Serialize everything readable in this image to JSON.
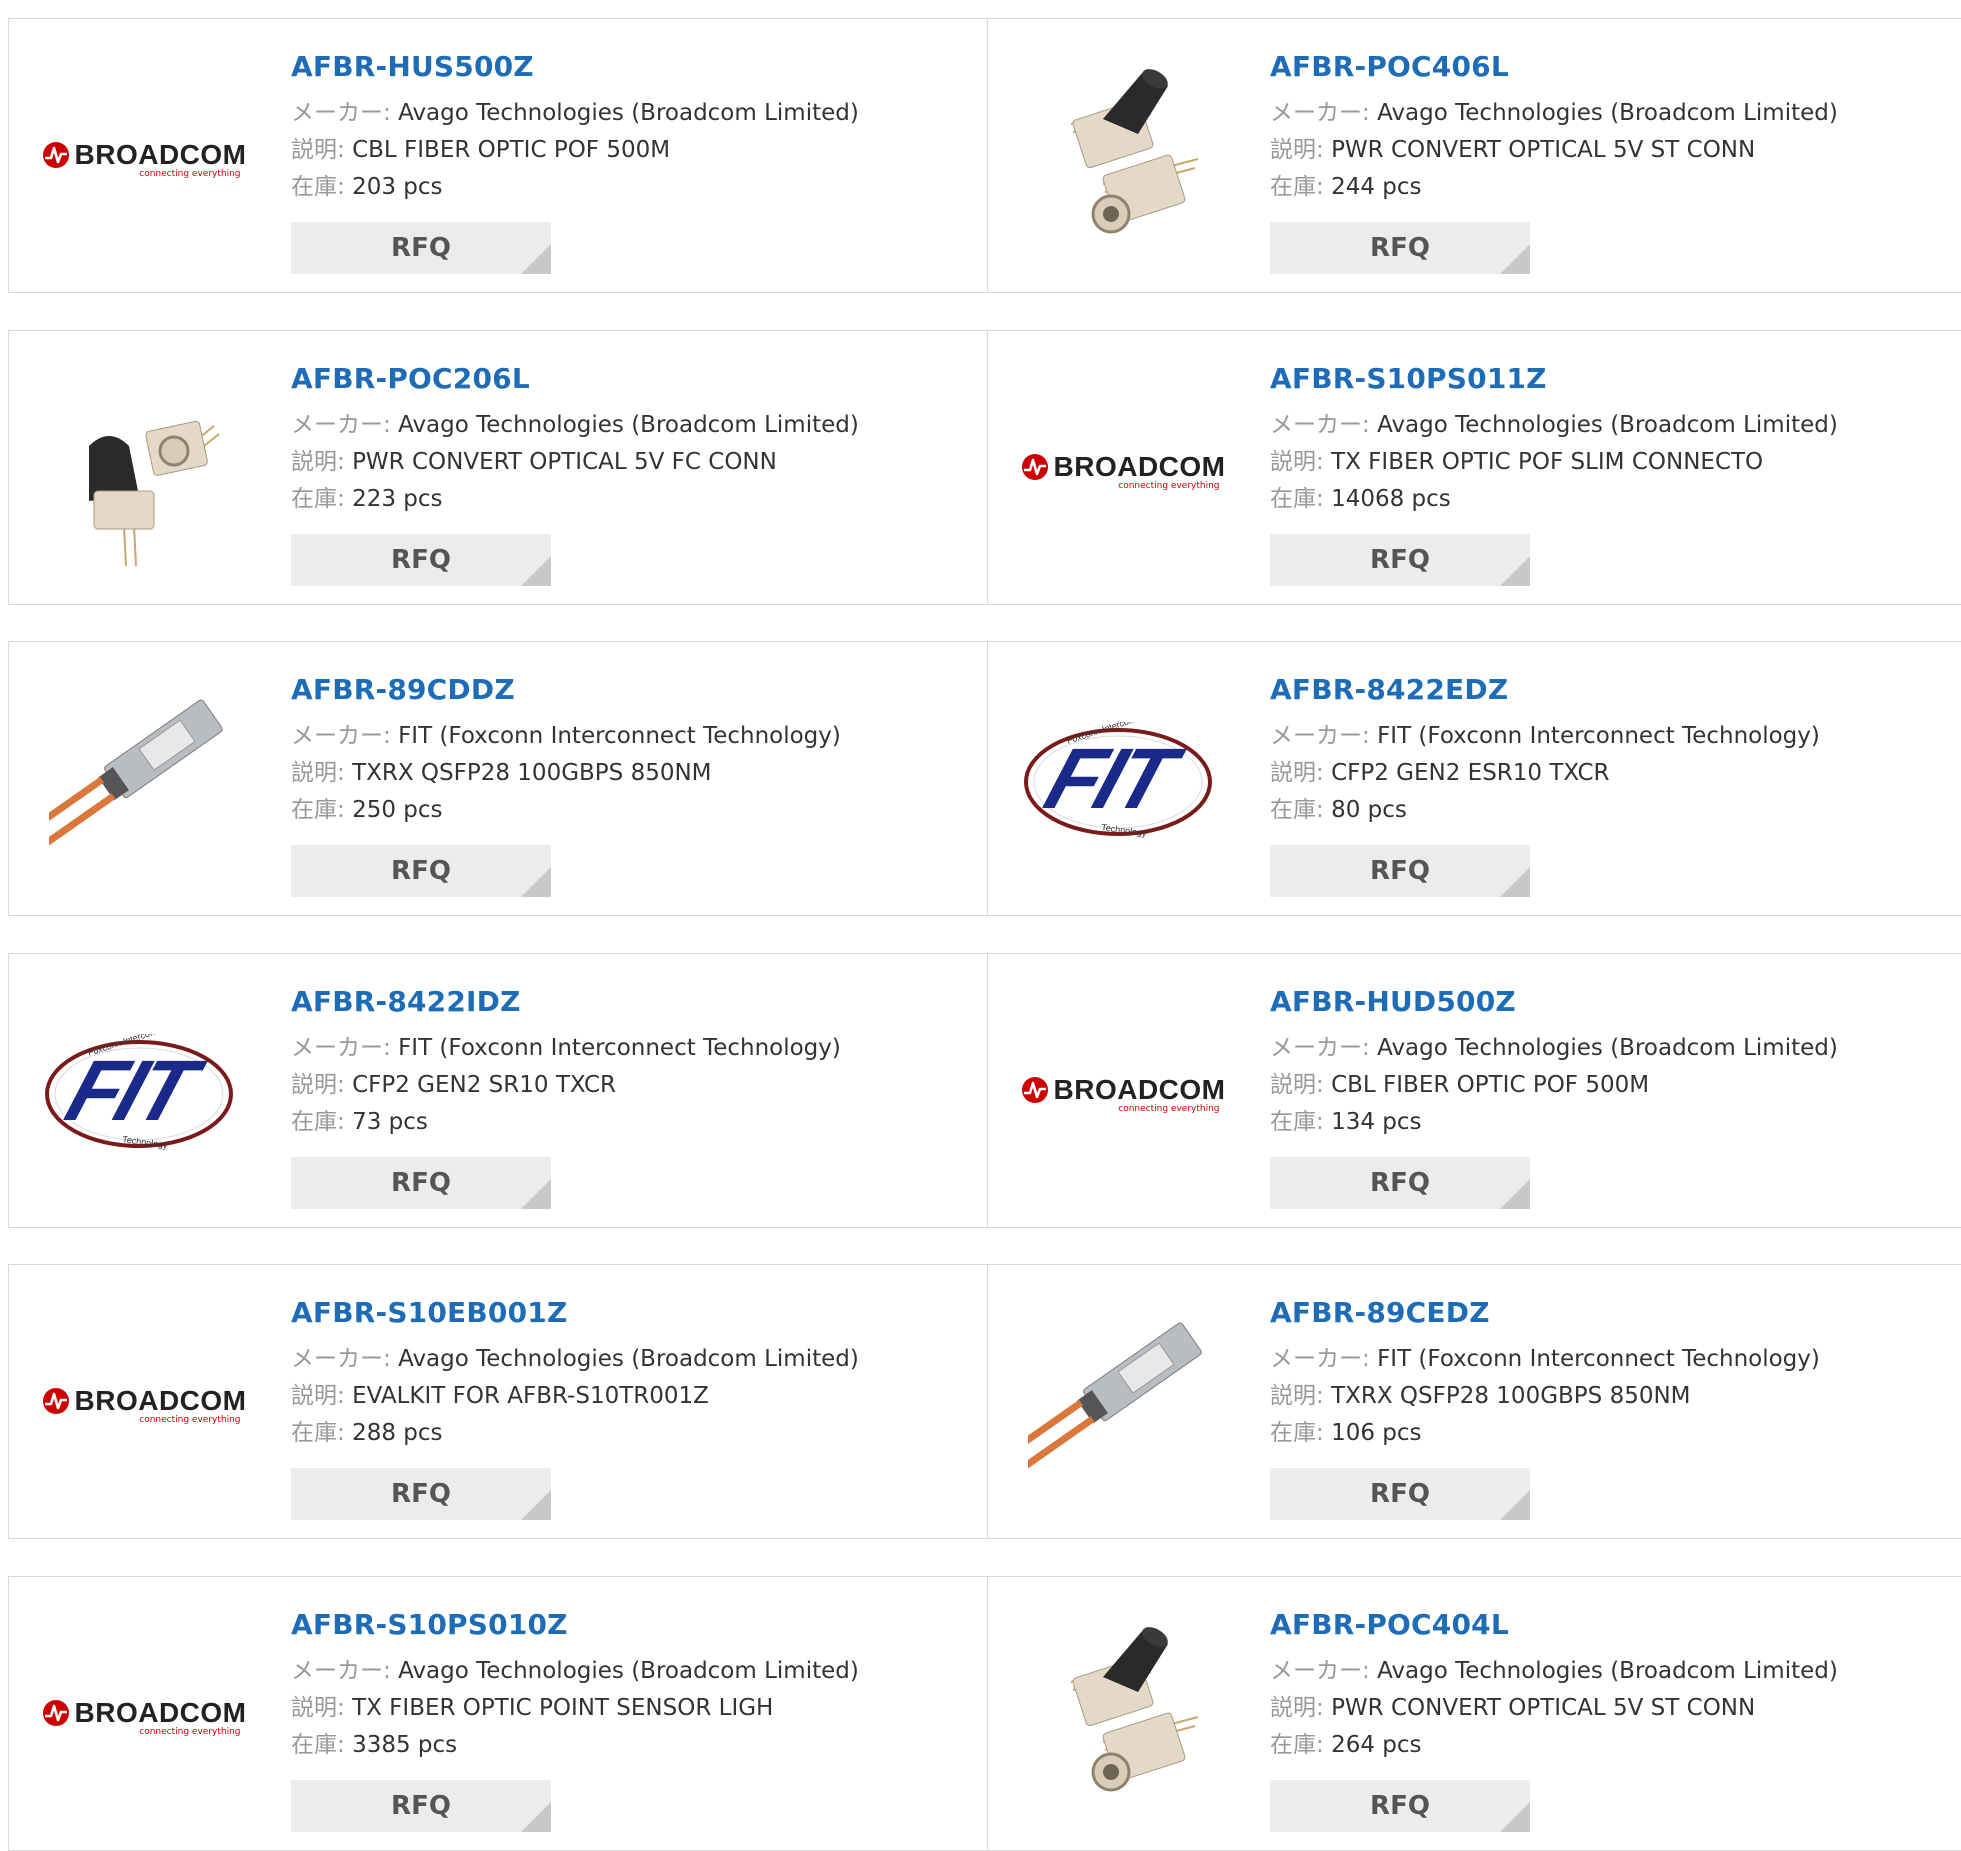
{
  "labels": {
    "maker": "メーカー:",
    "description": "説明:",
    "stock": "在庫:",
    "rfq": "RFQ"
  },
  "logos": {
    "broadcom": {
      "word": "BROADCOM",
      "tagline": "connecting everything"
    },
    "fit": {
      "word": "FIT",
      "ring_top": "Foxconn Interconnect",
      "ring_bottom": "Technology"
    }
  },
  "colors": {
    "part_link": "#1e6cb6",
    "broadcom_red": "#cc0000",
    "fit_blue": "#1b2a8a",
    "rfq_bg": "#ececec"
  },
  "products": [
    {
      "part": "AFBR-HUS500Z",
      "maker": "Avago Technologies (Broadcom Limited)",
      "description": "CBL FIBER OPTIC POF 500M",
      "stock": "203 pcs",
      "image": "broadcom-logo"
    },
    {
      "part": "AFBR-POC406L",
      "maker": "Avago Technologies (Broadcom Limited)",
      "description": "PWR CONVERT OPTICAL 5V ST CONN",
      "stock": "244 pcs",
      "image": "st-connector-photo"
    },
    {
      "part": "AFBR-POC206L",
      "maker": "Avago Technologies (Broadcom Limited)",
      "description": "PWR CONVERT OPTICAL 5V FC CONN",
      "stock": "223 pcs",
      "image": "fc-connector-photo"
    },
    {
      "part": "AFBR-S10PS011Z",
      "maker": "Avago Technologies (Broadcom Limited)",
      "description": "TX FIBER OPTIC POF SLIM CONNECTO",
      "stock": "14068 pcs",
      "image": "broadcom-logo"
    },
    {
      "part": "AFBR-89CDDZ",
      "maker": "FIT (Foxconn Interconnect Technology)",
      "description": "TXRX QSFP28 100GBPS 850NM",
      "stock": "250 pcs",
      "image": "qsfp-module-photo"
    },
    {
      "part": "AFBR-8422EDZ",
      "maker": "FIT (Foxconn Interconnect Technology)",
      "description": "CFP2 GEN2 ESR10 TXCR",
      "stock": "80 pcs",
      "image": "fit-logo"
    },
    {
      "part": "AFBR-8422IDZ",
      "maker": "FIT (Foxconn Interconnect Technology)",
      "description": "CFP2 GEN2 SR10 TXCR",
      "stock": "73 pcs",
      "image": "fit-logo"
    },
    {
      "part": "AFBR-HUD500Z",
      "maker": "Avago Technologies (Broadcom Limited)",
      "description": "CBL FIBER OPTIC POF 500M",
      "stock": "134 pcs",
      "image": "broadcom-logo"
    },
    {
      "part": "AFBR-S10EB001Z",
      "maker": "Avago Technologies (Broadcom Limited)",
      "description": "EVALKIT FOR AFBR-S10TR001Z",
      "stock": "288 pcs",
      "image": "broadcom-logo"
    },
    {
      "part": "AFBR-89CEDZ",
      "maker": "FIT (Foxconn Interconnect Technology)",
      "description": "TXRX QSFP28 100GBPS 850NM",
      "stock": "106 pcs",
      "image": "qsfp-module-photo"
    },
    {
      "part": "AFBR-S10PS010Z",
      "maker": "Avago Technologies (Broadcom Limited)",
      "description": "TX FIBER OPTIC POINT SENSOR LIGH",
      "stock": "3385 pcs",
      "image": "broadcom-logo"
    },
    {
      "part": "AFBR-POC404L",
      "maker": "Avago Technologies (Broadcom Limited)",
      "description": "PWR CONVERT OPTICAL 5V ST CONN",
      "stock": "264 pcs",
      "image": "st-connector-photo"
    }
  ]
}
